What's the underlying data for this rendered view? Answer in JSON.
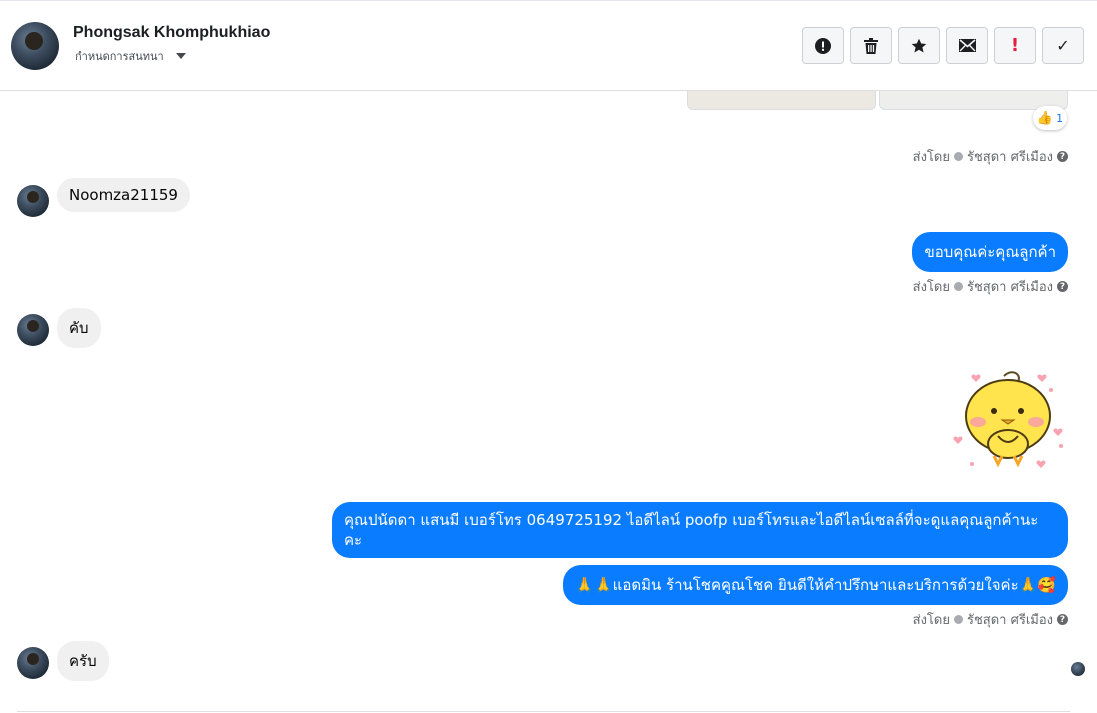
{
  "header": {
    "contact_name": "Phongsak Khomphukhiao",
    "assign_label": "กำหนดการสนทนา",
    "actions": [
      {
        "name": "mark-spam",
        "icon": "alert-circle-icon",
        "label": ""
      },
      {
        "name": "delete",
        "icon": "trash-icon",
        "label": ""
      },
      {
        "name": "star",
        "icon": "star-icon",
        "label": ""
      },
      {
        "name": "mark-unread",
        "icon": "envelope-icon",
        "label": ""
      },
      {
        "name": "follow-up",
        "icon": "exclamation-icon",
        "label": "!"
      },
      {
        "name": "done",
        "icon": "check-icon",
        "label": "✓"
      }
    ]
  },
  "colors": {
    "outgoing_bubble": "#0a7cff",
    "incoming_bubble": "#f0f0f0",
    "follow_up_red": "#e41e3f"
  },
  "reaction": {
    "emoji": "👍",
    "count": "1"
  },
  "sent_by_label": "ส่งโดย",
  "agent_name": "รัชสุดา ศรีเมือง",
  "messages": [
    {
      "direction": "in",
      "text": "Noomza21159"
    },
    {
      "direction": "out",
      "text": "ขอบคุณค่ะคุณลูกค้า"
    },
    {
      "direction": "in",
      "text": "คับ"
    },
    {
      "direction": "out",
      "type": "sticker",
      "icon": "yellow-chick-sticker"
    },
    {
      "direction": "out",
      "text": "คุณปนัดดา แสนมี   เบอร์โทร 0649725192  ไอดีไลน์ poofp   เบอร์โทรและไอดีไลน์เซลล์ที่จะดูแลคุณลูกค้านะคะ"
    },
    {
      "direction": "out",
      "text": "🙏🙏แอดมิน ร้านโชคคูณโชค ยินดีให้คำปรึกษาและบริการด้วยใจค่ะ🙏🥰"
    },
    {
      "direction": "in",
      "text": "ครับ"
    }
  ]
}
